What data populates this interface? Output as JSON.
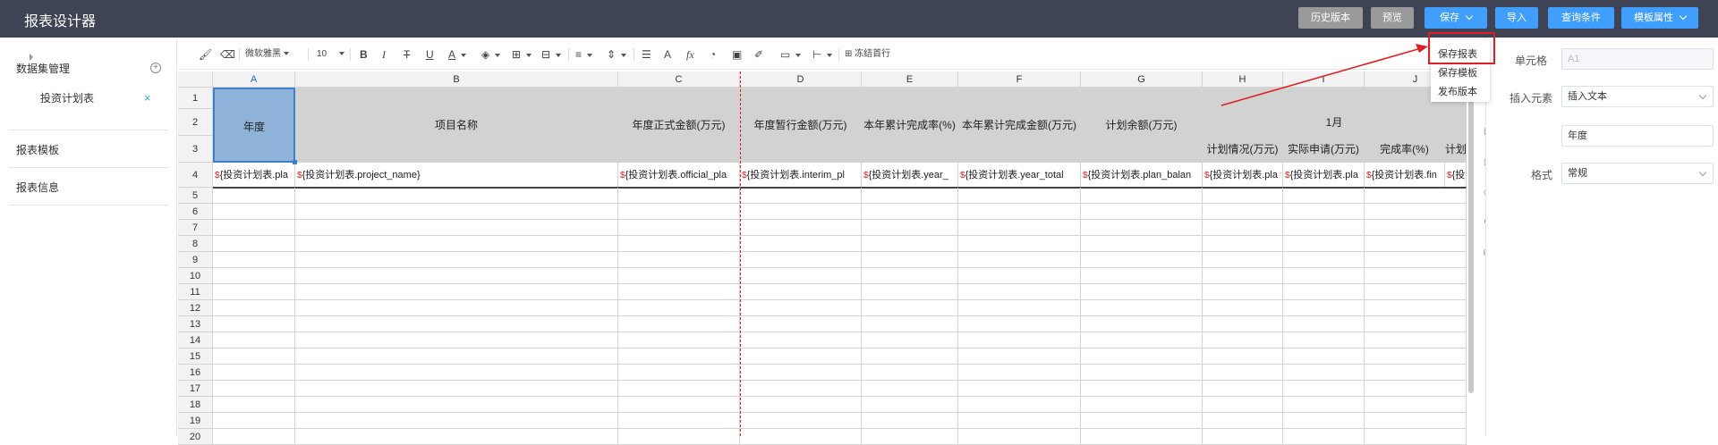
{
  "header": {
    "title": "报表设计器",
    "buttons": {
      "history": "历史版本",
      "preview": "预览",
      "save": "保存",
      "import": "导入",
      "query": "查询条件",
      "template_props": "模板属性"
    }
  },
  "save_menu": {
    "items": [
      "保存报表",
      "保存模板",
      "发布版本"
    ]
  },
  "left_panel": {
    "dataset_title": "数据集管理",
    "dataset_item": "投资计划表",
    "template_title": "报表模板",
    "info_title": "报表信息"
  },
  "toolbar": {
    "font": "微软雅黑",
    "size": "10",
    "freeze": "冻结首行"
  },
  "grid": {
    "columns": [
      "A",
      "B",
      "C",
      "D",
      "E",
      "F",
      "G",
      "H",
      "I",
      "J"
    ],
    "rows": [
      "1",
      "2",
      "3",
      "4",
      "5",
      "6",
      "7",
      "8",
      "9",
      "10",
      "11",
      "12",
      "13",
      "14",
      "15",
      "16",
      "17",
      "18",
      "19",
      "20"
    ],
    "headers": {
      "year": "年度",
      "project_name": "项目名称",
      "official_plan": "年度正式金额(万元)",
      "interim_plan": "年度暂行金额(万元)",
      "year_rate": "本年累计完成率(%)",
      "year_total": "本年累计完成金额(万元)",
      "plan_balance": "计划余额(万元)",
      "month": "1月",
      "plan_status": "计划情况(万元)",
      "actual_apply": "实际申请(万元)",
      "finish_rate": "完成率(%)",
      "plan_cut": "计划"
    },
    "row4": [
      "{投资计划表.pla",
      "{投资计划表.project_name}",
      "{投资计划表.official_pla",
      "{投资计划表.interim_pl",
      "{投资计划表.year_",
      "{投资计划表.year_total",
      "{投资计划表.plan_balan",
      "{投资计划表.pla",
      "{投资计划表.pla",
      "{投资计划表.fin",
      "{投"
    ],
    "dollar": "$"
  },
  "right_panel": {
    "cell_label": "单元格",
    "cell_value": "A1",
    "insert_label": "插入元素",
    "insert_value": "插入文本",
    "text_value": "年度",
    "format_label": "格式",
    "format_value": "常规"
  },
  "colors": {
    "header_bg": "#3f4454",
    "accent": "#409eff",
    "highlight": "#e02020"
  }
}
